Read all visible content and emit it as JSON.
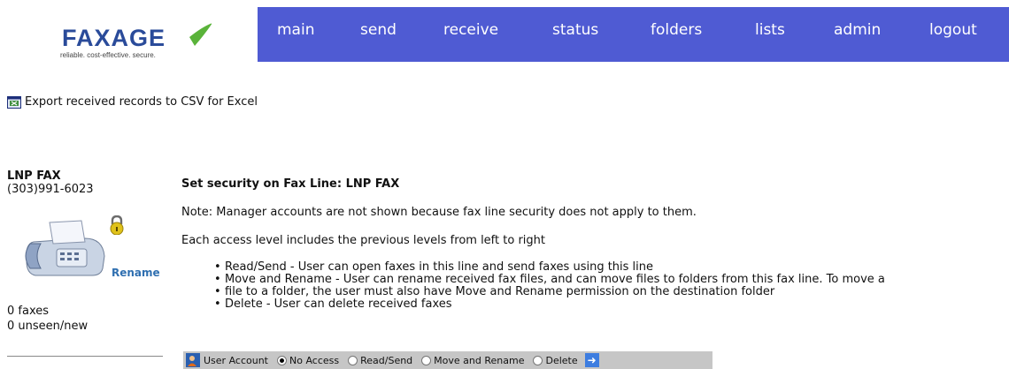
{
  "header": {
    "logo_text": "FAXAGE",
    "logo_tagline": "reliable. cost-effective. secure.",
    "nav": [
      "main",
      "send",
      "receive",
      "status",
      "folders",
      "lists",
      "admin",
      "logout"
    ]
  },
  "export_link": "Export received records to CSV for Excel",
  "fax_line": {
    "name": "LNP FAX",
    "number": "(303)991-6023",
    "rename_label": "Rename",
    "faxes": "0 faxes",
    "unseen": "0 unseen/new"
  },
  "security": {
    "heading": "Set security on Fax Line: LNP FAX",
    "note": "Note: Manager accounts are not shown because fax line security does not apply to them.",
    "levels_text": "Each access level includes the previous levels from left to right",
    "bullets": [
      "Read/Send - User can open faxes in this line and send faxes using this line",
      "Move and Rename - User can rename received fax files, and can move files to folders from this fax line. To move a",
      "file to a folder, the user must also have Move and Rename permission on the destination folder",
      "Delete - User can delete received faxes"
    ],
    "user_account_label": "User Account",
    "options": [
      "No Access",
      "Read/Send",
      "Move and Rename",
      "Delete"
    ],
    "selected": "No Access"
  },
  "colors": {
    "nav_bg": "#4f5bd3",
    "logo_blue": "#2a4b9a",
    "logo_swoosh": "#5ab33a",
    "link": "#2f6fb0",
    "access_row_bg": "#c6c6c6"
  },
  "icons": [
    "export-csv-icon",
    "fax-machine-icon",
    "lock-icon",
    "user-account-icon",
    "arrow-right-icon"
  ]
}
